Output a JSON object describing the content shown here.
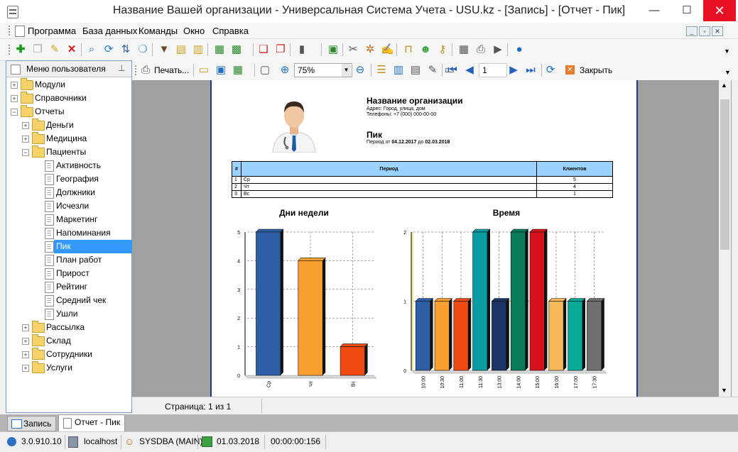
{
  "window": {
    "title": "Название Вашей организации - Универсальная Система Учета - USU.kz - [Запись] - [Отчет - Пик]",
    "minimize": "—",
    "maximize": "☐",
    "close": "✕"
  },
  "menu": {
    "items": [
      "Программа",
      "База данных",
      "Команды",
      "Окно",
      "Справка"
    ]
  },
  "sidebar": {
    "title": "Меню пользователя",
    "items": [
      {
        "label": "Модули",
        "level": 0,
        "type": "folder",
        "expander": "+"
      },
      {
        "label": "Справочники",
        "level": 0,
        "type": "folder",
        "expander": "+"
      },
      {
        "label": "Отчеты",
        "level": 0,
        "type": "folder",
        "expander": "−"
      },
      {
        "label": "Деньги",
        "level": 1,
        "type": "folder",
        "expander": "+"
      },
      {
        "label": "Медицина",
        "level": 1,
        "type": "folder",
        "expander": "+"
      },
      {
        "label": "Пациенты",
        "level": 1,
        "type": "folder",
        "expander": "−"
      },
      {
        "label": "Активность",
        "level": 2,
        "type": "doc"
      },
      {
        "label": "География",
        "level": 2,
        "type": "doc"
      },
      {
        "label": "Должники",
        "level": 2,
        "type": "doc"
      },
      {
        "label": "Исчезли",
        "level": 2,
        "type": "doc"
      },
      {
        "label": "Маркетинг",
        "level": 2,
        "type": "doc"
      },
      {
        "label": "Напоминания",
        "level": 2,
        "type": "doc"
      },
      {
        "label": "Пик",
        "level": 2,
        "type": "doc",
        "selected": true
      },
      {
        "label": "План работ",
        "level": 2,
        "type": "doc"
      },
      {
        "label": "Прирост",
        "level": 2,
        "type": "doc"
      },
      {
        "label": "Рейтинг",
        "level": 2,
        "type": "doc"
      },
      {
        "label": "Средний чек",
        "level": 2,
        "type": "doc"
      },
      {
        "label": "Ушли",
        "level": 2,
        "type": "doc"
      },
      {
        "label": "Рассылка",
        "level": 1,
        "type": "folder",
        "expander": "+"
      },
      {
        "label": "Склад",
        "level": 1,
        "type": "folder",
        "expander": "+"
      },
      {
        "label": "Сотрудники",
        "level": 1,
        "type": "folder",
        "expander": "+"
      },
      {
        "label": "Услуги",
        "level": 1,
        "type": "folder",
        "expander": "+"
      }
    ]
  },
  "report_toolbar": {
    "print_label": "Печать...",
    "zoom": "75%",
    "page_number": "1",
    "close_label": "Закрыть"
  },
  "report": {
    "org_name": "Название организации",
    "address": "Адрес: Город, улица, дом",
    "phones": "Телефоны: +7 (000) 000-00-00",
    "title": "Пик",
    "period_prefix": "Период от",
    "period_from": "04.12.2017",
    "period_mid": "до",
    "period_to": "02.03.2018",
    "table": {
      "headers": [
        "#",
        "Период",
        "Клиентов"
      ],
      "rows": [
        [
          "1",
          "Ср",
          "5"
        ],
        [
          "2",
          "Чт",
          "4"
        ],
        [
          "3",
          "Вс",
          "1"
        ]
      ]
    }
  },
  "chart_data": [
    {
      "type": "bar",
      "title": "Дни недели",
      "categories": [
        "Ср",
        "Чт",
        "Вс"
      ],
      "values": [
        5,
        4,
        1
      ],
      "colors": [
        "#2e5fa6",
        "#f7a030",
        "#f04a10"
      ],
      "yticks": [
        "0",
        "1",
        "2",
        "3",
        "4",
        "5"
      ],
      "ylim": [
        0,
        5
      ],
      "grid": true
    },
    {
      "type": "bar",
      "title": "Время",
      "categories": [
        "10:00",
        "10:30",
        "11:00",
        "11:30",
        "13:00",
        "14:00",
        "15:00",
        "16:00",
        "17:00",
        "17:30"
      ],
      "values": [
        1,
        1,
        1,
        2,
        1,
        2,
        2,
        1,
        1,
        1
      ],
      "colors": [
        "#2e5fa6",
        "#f7a030",
        "#f04a10",
        "#0b9ba3",
        "#1b3566",
        "#0b7a5a",
        "#d4121a",
        "#f6b95a",
        "#0aa896",
        "#707070"
      ],
      "yticks": [
        "0",
        "1",
        "2"
      ],
      "ylim": [
        0,
        2
      ],
      "grid": true
    }
  ],
  "status": {
    "page": "Страница: 1 из 1"
  },
  "tabs": [
    {
      "label": "Запись"
    },
    {
      "label": "Отчет - Пик"
    }
  ],
  "statusbar": {
    "version": "3.0.910.10",
    "server": "localhost",
    "user": "SYSDBA (MAIN)",
    "date": "01.03.2018",
    "timer": "00:00:00:156"
  }
}
